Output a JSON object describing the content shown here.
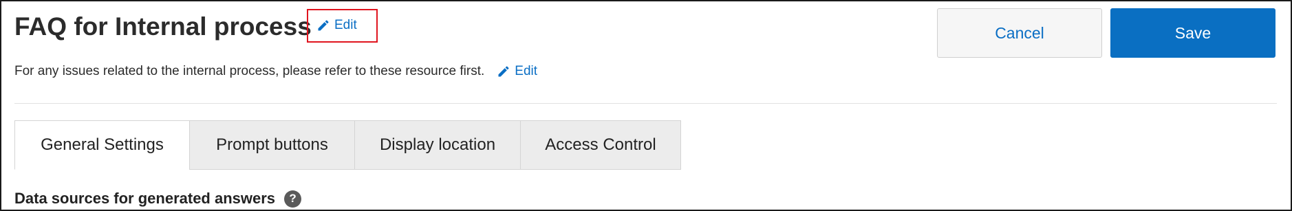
{
  "header": {
    "title": "FAQ for Internal process",
    "title_edit_label": "Edit",
    "description": "For any issues related to the internal process, please refer to these resource first.",
    "description_edit_label": "Edit"
  },
  "actions": {
    "cancel_label": "Cancel",
    "save_label": "Save"
  },
  "tabs": [
    {
      "label": "General Settings",
      "active": true
    },
    {
      "label": "Prompt buttons",
      "active": false
    },
    {
      "label": "Display location",
      "active": false
    },
    {
      "label": "Access Control",
      "active": false
    }
  ],
  "section": {
    "heading": "Data sources for generated answers",
    "help_icon_glyph": "?"
  },
  "icons": {
    "edit": "pencil-icon",
    "help": "question-circle-icon"
  },
  "colors": {
    "accent": "#0a6ec4",
    "primary_button": "#0a6fc2",
    "highlight_border": "#e0141e",
    "tab_inactive_bg": "#ececec"
  }
}
